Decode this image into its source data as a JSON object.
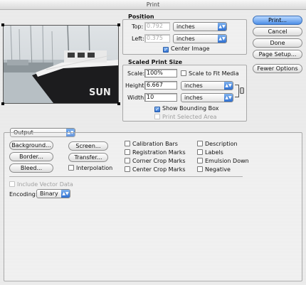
{
  "window": {
    "title": "Print"
  },
  "position": {
    "legend": "Position",
    "top_label": "Top:",
    "top_value": "0.792",
    "top_unit": "inches",
    "left_label": "Left:",
    "left_value": "0.375",
    "left_unit": "inches",
    "center_image": "Center Image"
  },
  "scaled": {
    "legend": "Scaled Print Size",
    "scale_label": "Scale:",
    "scale_value": "100%",
    "scale_to_fit": "Scale to Fit Media",
    "height_label": "Height:",
    "height_value": "6.667",
    "height_unit": "inches",
    "width_label": "Width:",
    "width_value": "10",
    "width_unit": "inches",
    "show_bounding_box": "Show Bounding Box",
    "print_selected_area": "Print Selected Area"
  },
  "buttons": {
    "print": "Print...",
    "cancel": "Cancel",
    "done": "Done",
    "page_setup": "Page Setup...",
    "fewer_options": "Fewer Options"
  },
  "output": {
    "section_select": "Output",
    "background": "Background...",
    "border": "Border...",
    "bleed": "Bleed...",
    "screen": "Screen...",
    "transfer": "Transfer...",
    "interpolation": "Interpolation",
    "calibration_bars": "Calibration Bars",
    "registration_marks": "Registration Marks",
    "corner_crop_marks": "Corner Crop Marks",
    "center_crop_marks": "Center Crop Marks",
    "description": "Description",
    "labels": "Labels",
    "emulsion_down": "Emulsion Down",
    "negative": "Negative",
    "include_vector_data": "Include Vector Data",
    "encoding_label": "Encoding:",
    "encoding_value": "Binary"
  },
  "preview": {
    "boat_text": "SUN"
  },
  "icons": {
    "arrow": "▲▼",
    "check": "✓"
  },
  "colors": {
    "accent": "#2d6fd1"
  }
}
